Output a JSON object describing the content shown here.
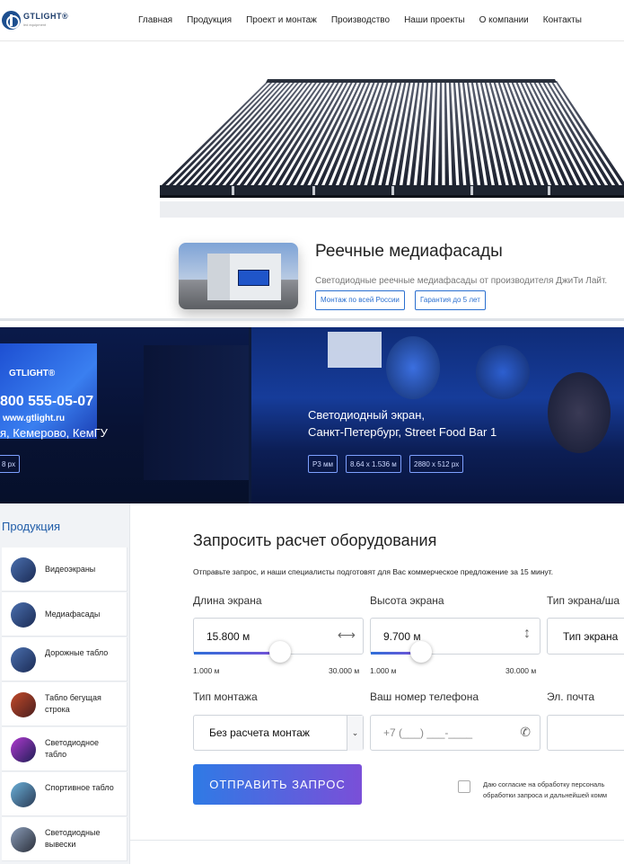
{
  "nav": {
    "logo_text": "GTLIGHT®",
    "logo_sub": "led equipment",
    "items": [
      "Главная",
      "Продукция",
      "Проект и монтаж",
      "Производство",
      "Наши проекты",
      "О компании",
      "Контакты"
    ]
  },
  "hero": {
    "title": "Реечные медиафасады",
    "subtitle": "Светодиодные реечные медиафасады от производителя ДжиТи Лайт.",
    "tags": [
      "Монтаж по всей России",
      "Гарантия до 5 лет"
    ]
  },
  "projects": {
    "left": {
      "screen_brand": "GTLIGHT®",
      "screen_phone": "800 555-05-07",
      "screen_url": "www.gtlight.ru",
      "title": "я, Кемерово, КемГУ",
      "tags": [
        "8 px"
      ]
    },
    "right": {
      "title_line1": "Светодиодный экран,",
      "title_line2": "Санкт-Петербург, Street Food Bar 1",
      "tags": [
        "P3 мм",
        "8.64 x 1.536 м",
        "2880 x 512 px"
      ]
    }
  },
  "sidebar": {
    "title": "Продукция",
    "items": [
      {
        "label": "Видеоэкраны"
      },
      {
        "label": "Медиафасады"
      },
      {
        "label": "Дорожные табло"
      },
      {
        "label": "Табло бегущая строка"
      },
      {
        "label": "Светодиодное табло"
      },
      {
        "label": "Спортивное табло"
      },
      {
        "label": "Светодиодные вывески"
      }
    ]
  },
  "form": {
    "title": "Запросить расчет оборудования",
    "description": "Отправьте запрос, и наши специалисты подготовят для Вас коммерческое предложение за 15 минут.",
    "length": {
      "label": "Длина экрана",
      "value": "15.800 м",
      "min": "1.000 м",
      "max": "30.000 м",
      "fraction": 0.51
    },
    "height": {
      "label": "Высота экрана",
      "value": "9.700 м",
      "min": "1.000 м",
      "max": "30.000 м",
      "fraction": 0.3
    },
    "type": {
      "label": "Тип экрана/ша",
      "value": "Тип экрана"
    },
    "mount": {
      "label": "Тип монтажа",
      "value": "Без расчета монтаж"
    },
    "phone": {
      "label": "Ваш номер телефона",
      "placeholder": "+7 (___) ___-____"
    },
    "email": {
      "label": "Эл. почта",
      "placeholder": ""
    },
    "submit_label": "ОТПРАВИТЬ ЗАПРОС",
    "consent_line1": "Даю согласие на обработку персональ",
    "consent_line2": "обработки запроса и дальнейшей комм"
  },
  "colors": {
    "accent": "#2a6fcf",
    "button_start": "#2f7ae5",
    "button_end": "#7a4fd8"
  },
  "icons": {
    "length": "horizontal-arrows-icon",
    "height": "vertical-arrows-icon",
    "phone": "phone-icon",
    "dropdown": "chevron-down-icon"
  }
}
